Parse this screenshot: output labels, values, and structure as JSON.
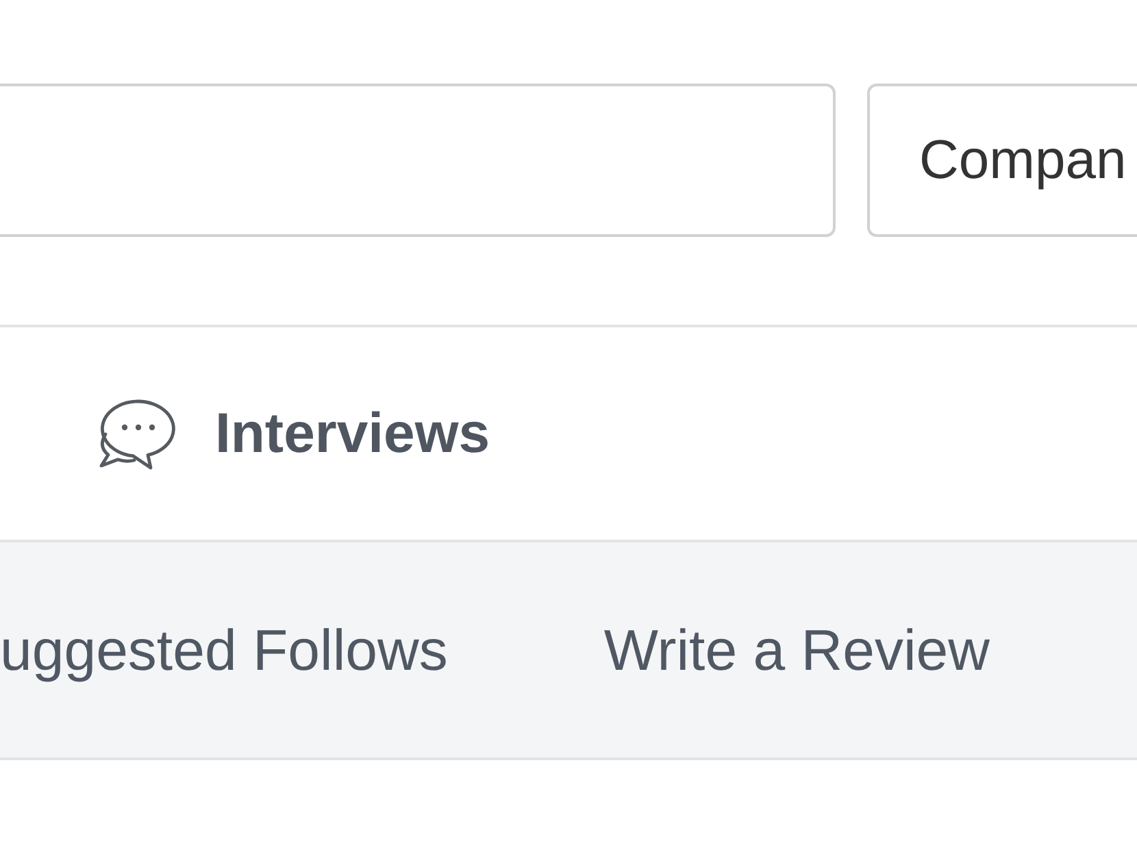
{
  "search_bar": {
    "dropdown": {
      "value": "Compan"
    }
  },
  "nav": {
    "items": [
      {
        "label": "Interviews"
      }
    ]
  },
  "links": [
    {
      "label": "uggested Follows"
    },
    {
      "label": "Write a Review"
    }
  ]
}
